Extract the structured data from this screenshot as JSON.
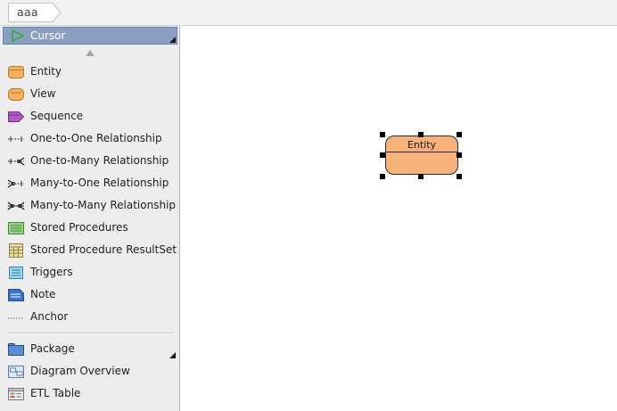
{
  "breadcrumb": {
    "label": "aaa"
  },
  "palette": {
    "cursor_label": "Cursor",
    "items": [
      {
        "label": "Entity",
        "icon": "entity-icon"
      },
      {
        "label": "View",
        "icon": "view-icon"
      },
      {
        "label": "Sequence",
        "icon": "sequence-icon"
      },
      {
        "label": "One-to-One Relationship",
        "icon": "one-to-one-relationship-icon"
      },
      {
        "label": "One-to-Many Relationship",
        "icon": "one-to-many-relationship-icon"
      },
      {
        "label": "Many-to-One Relationship",
        "icon": "many-to-one-relationship-icon"
      },
      {
        "label": "Many-to-Many Relationship",
        "icon": "many-to-many-relationship-icon"
      },
      {
        "label": "Stored Procedures",
        "icon": "stored-procedures-icon"
      },
      {
        "label": "Stored Procedure ResultSet",
        "icon": "stored-procedure-resultset-icon"
      },
      {
        "label": "Triggers",
        "icon": "triggers-icon"
      },
      {
        "label": "Note",
        "icon": "note-icon"
      },
      {
        "label": "Anchor",
        "icon": "anchor-icon"
      },
      {
        "label": "Package",
        "icon": "package-icon"
      },
      {
        "label": "Diagram Overview",
        "icon": "diagram-overview-icon"
      },
      {
        "label": "ETL Table",
        "icon": "etl-table-icon"
      }
    ]
  },
  "canvas": {
    "entity": {
      "name": "Entity"
    }
  },
  "colors": {
    "entity_fill": "#f7b27a",
    "selection_bg": "#8a9fbf",
    "palette_bg": "#ededed"
  }
}
